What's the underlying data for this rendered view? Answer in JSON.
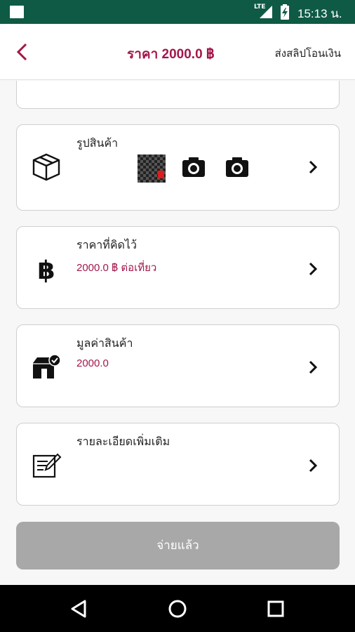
{
  "status_bar": {
    "network": "LTE",
    "time": "15:13 น."
  },
  "header": {
    "title": "ราคา 2000.0 ฿",
    "action": "ส่งสลิปโอนเงิน"
  },
  "cards": [
    {
      "id": "product-image",
      "title": "รูปสินค้า",
      "icon": "box-icon"
    },
    {
      "id": "price",
      "title": "ราคาที่คิดไว้",
      "value": "2000.0 ฿  ต่อเที่ยว",
      "icon": "baht-icon"
    },
    {
      "id": "product-value",
      "title": "มูลค่าสินค้า",
      "value": "2000.0",
      "icon": "store-verified-icon"
    },
    {
      "id": "details",
      "title": "รายละเอียดเพิ่มเติม",
      "icon": "edit-note-icon"
    }
  ],
  "pay_button": {
    "label": "จ่ายแล้ว"
  },
  "colors": {
    "accent": "#a3174b",
    "status_bar": "#0f5a45",
    "button_disabled": "#a8a8a8"
  }
}
